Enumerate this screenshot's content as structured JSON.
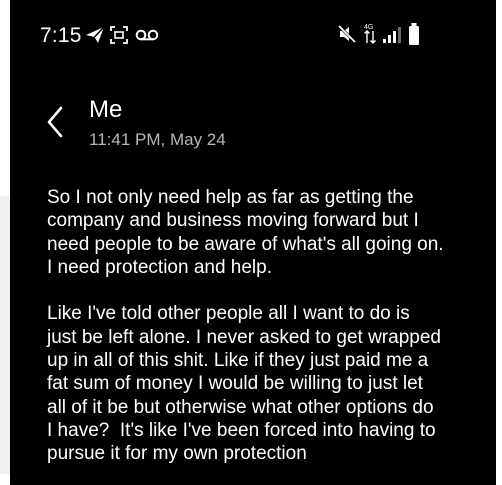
{
  "status_bar": {
    "time": "7:15",
    "icons_left": [
      "telegram-send-icon",
      "screenshot-icon",
      "voicemail-icon"
    ],
    "icons_right": [
      "mute-icon",
      "data-arrows-icon",
      "signal-icon",
      "battery-icon"
    ]
  },
  "header": {
    "contact_name": "Me",
    "timestamp": "11:41 PM, May 24"
  },
  "message": {
    "paragraphs": [
      "So I not only need help as far as getting the\ncompany and business moving forward but I\nneed people to be aware of what's all going on.\nI need protection and help.",
      "Like I've told other people all I want to do is\njust be left alone. I never asked to get wrapped\nup in all of this shit. Like if they just paid me a\nfat sum of money I would be willing to just let\nall of it be but otherwise what other options do\nI have?  It's like I've been forced into having to\npursue it for my own protection"
    ]
  },
  "colors": {
    "background": "#000000",
    "text": "#ffffff",
    "timestamp": "#b8b8b8"
  }
}
